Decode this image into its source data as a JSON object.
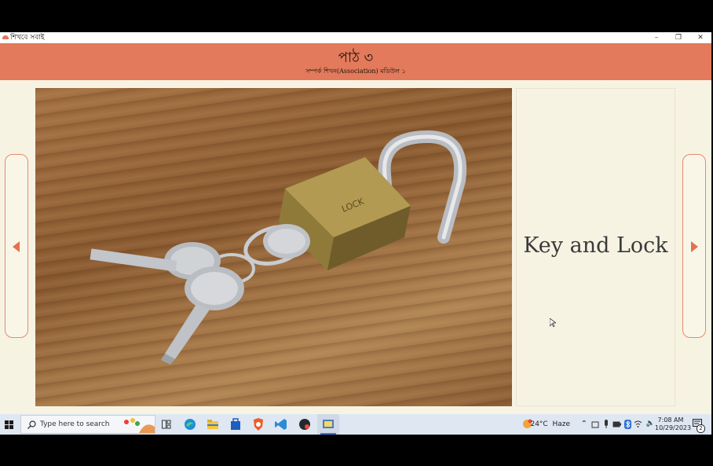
{
  "window": {
    "title": "শিখবে সবাই"
  },
  "header": {
    "title": "পাঠ ৩",
    "subtitle": "সম্পর্ক শিখন(Association) মডিউল ১"
  },
  "content": {
    "image_alt": "keys on a padlock",
    "caption": "Key and Lock"
  },
  "taskbar": {
    "search_placeholder": "Type here to search",
    "weather": "24°C  Haze",
    "time": "7:08 AM",
    "date": "10/29/2023",
    "notification_count": "2"
  },
  "colors": {
    "header_bg": "#e27a5b",
    "page_bg": "#f7f3e3",
    "accent": "#e58a6a"
  }
}
